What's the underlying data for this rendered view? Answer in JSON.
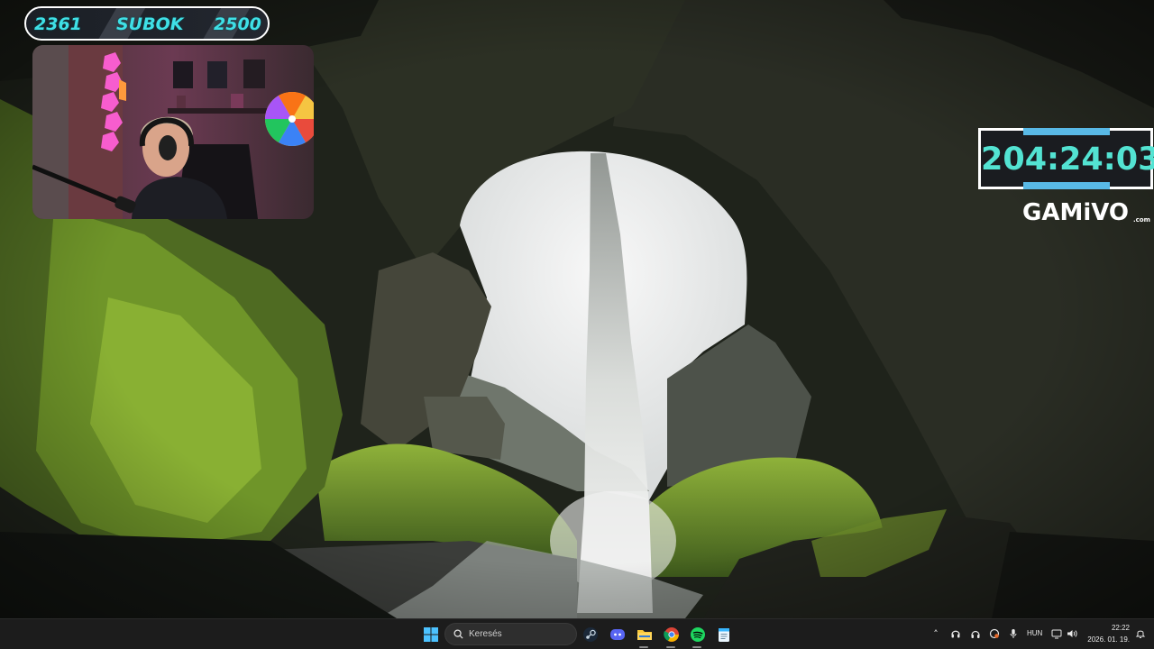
{
  "overlay": {
    "subgoal": {
      "current": "2361",
      "label": "SUBOK",
      "target": "2500"
    },
    "timer": {
      "value": "204:24:03"
    },
    "sponsor": {
      "name": "GAMiVO",
      "domain": ".com"
    }
  },
  "taskbar": {
    "search_placeholder": "Keresés",
    "pinned": [
      "windows-start",
      "search",
      "steam",
      "discord",
      "file-explorer",
      "chrome",
      "spotify",
      "notepad"
    ],
    "tray": {
      "language": "HUN",
      "time": "22:22",
      "date": "2026. 01. 19."
    }
  },
  "colors": {
    "accent_cyan": "#3fe0e6",
    "timer_text": "#53e3d2",
    "timer_bars": "#59b9e6",
    "taskbar_bg": "#1c1c1c"
  }
}
